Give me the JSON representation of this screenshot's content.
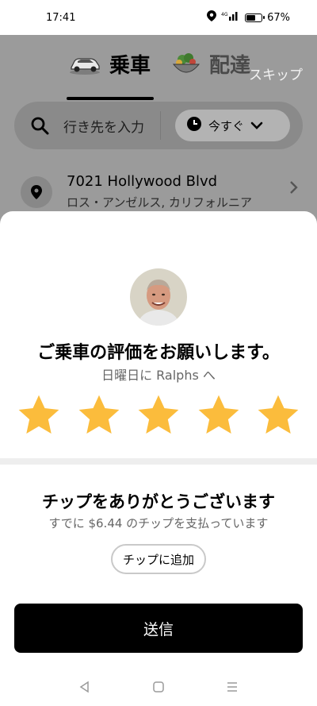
{
  "status_bar": {
    "time": "17:41",
    "battery_percent": "67%",
    "battery_level": 0.67,
    "network": "4G"
  },
  "header": {
    "tabs": [
      {
        "label": "乗車"
      },
      {
        "label": "配達"
      }
    ],
    "skip_label": "スキップ"
  },
  "search": {
    "placeholder": "行き先を入力",
    "time_option": "今すぐ"
  },
  "recent_place": {
    "title": "7021 Hollywood Blvd",
    "subtitle": "ロス・アンゼルス, カリフォルニア"
  },
  "rating": {
    "title": "ご乗車の評価をお願いします。",
    "subtitle": "日曜日に Ralphs へ",
    "stars_selected": 5,
    "stars_total": 5,
    "star_color": "#FBBC3C"
  },
  "tip": {
    "title": "チップをありがとうございます",
    "subtitle": "すでに $6.44 のチップを支払っています",
    "add_button": "チップに追加"
  },
  "submit_label": "送信",
  "nav": {
    "back": "◁",
    "home": "○",
    "menu": "☰"
  }
}
